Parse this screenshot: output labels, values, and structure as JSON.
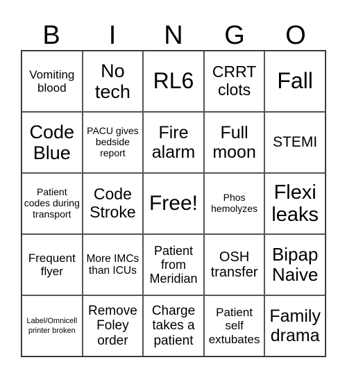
{
  "header": {
    "letters": [
      "B",
      "I",
      "N",
      "G",
      "O"
    ]
  },
  "board": {
    "cells": [
      [
        "Vomiting blood",
        "No tech",
        "RL6",
        "CRRT clots",
        "Fall"
      ],
      [
        "Code Blue",
        "PACU gives bedside report",
        "Fire alarm",
        "Full moon",
        "STEMI"
      ],
      [
        "Patient codes during transport",
        "Code Stroke",
        "Free!",
        "Phos hemolyzes",
        "Flexi leaks"
      ],
      [
        "Frequent flyer",
        "More IMCs than ICUs",
        "Patient from Meridian",
        "OSH transfer",
        "Bipap Naive"
      ],
      [
        "Label/Omnicell printer broken",
        "Remove Foley order",
        "Charge takes a patient",
        "Patient self extubates",
        "Family drama"
      ]
    ]
  }
}
